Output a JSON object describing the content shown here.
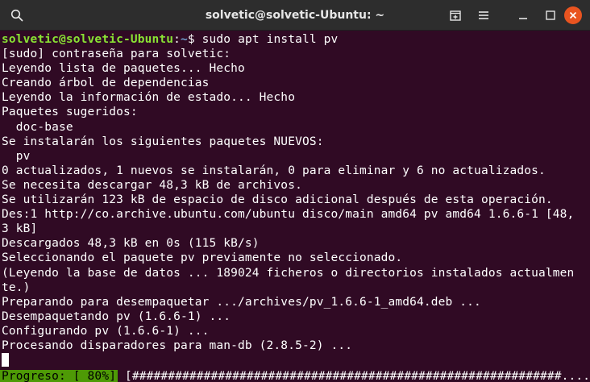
{
  "window": {
    "title": "solvetic@solvetic-Ubuntu: ~",
    "icons": [
      "search-icon",
      "new-tab-icon",
      "hamburger-menu-icon",
      "minimize-icon",
      "maximize-icon",
      "close-icon"
    ],
    "colors": {
      "titlebar": "#2d2d2d",
      "terminal_bg": "#300a24",
      "prompt_user": "#8ae234",
      "prompt_path": "#729fcf",
      "close_button": "#e95420",
      "progress_bg": "#4e9a06"
    }
  },
  "terminal": {
    "prompt": {
      "user_host": "solvetic@solvetic-Ubuntu",
      "path": "~",
      "symbol": "$ ",
      "command": "sudo apt install pv"
    },
    "lines": [
      "[sudo] contraseña para solvetic:",
      "Leyendo lista de paquetes... Hecho",
      "Creando árbol de dependencias",
      "Leyendo la información de estado... Hecho",
      "Paquetes sugeridos:",
      "  doc-base",
      "Se instalarán los siguientes paquetes NUEVOS:",
      "  pv",
      "0 actualizados, 1 nuevos se instalarán, 0 para eliminar y 6 no actualizados.",
      "Se necesita descargar 48,3 kB de archivos.",
      "Se utilizarán 123 kB de espacio de disco adicional después de esta operación.",
      "Des:1 http://co.archive.ubuntu.com/ubuntu disco/main amd64 pv amd64 1.6.6-1 [48,",
      "3 kB]",
      "Descargados 48,3 kB en 0s (115 kB/s)",
      "Seleccionando el paquete pv previamente no seleccionado.",
      "(Leyendo la base de datos ... 189024 ficheros o directorios instalados actualmen",
      "te.)",
      "Preparando para desempaquetar .../archives/pv_1.6.6-1_amd64.deb ...",
      "Desempaquetando pv (1.6.6-1) ...",
      "Configurando pv (1.6.6-1) ...",
      "Procesando disparadores para man-db (2.8.5-2) ..."
    ],
    "progress": {
      "label": "Progreso: [ 80%]",
      "bar": " [############################################################...........] ",
      "percent": 80
    }
  }
}
